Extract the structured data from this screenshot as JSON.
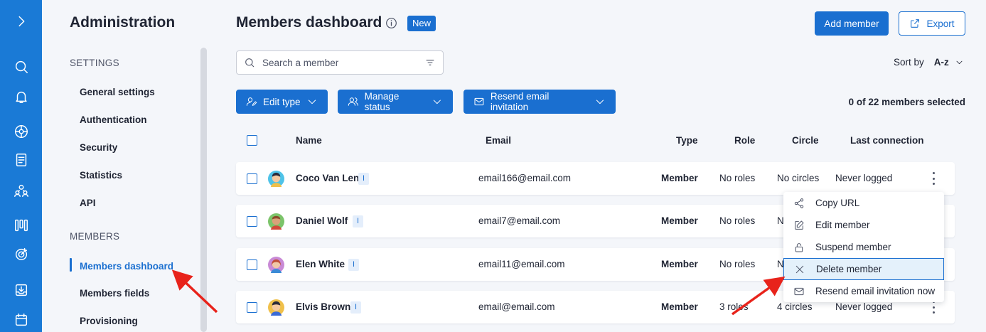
{
  "rail": {
    "icons": [
      "chevron-right-icon",
      "search-icon",
      "bell-icon",
      "compass-icon",
      "document-icon",
      "people-icon",
      "columns-icon",
      "target-icon",
      "inbox-icon",
      "calendar-icon"
    ]
  },
  "sidebar": {
    "title": "Administration",
    "settings_label": "SETTINGS",
    "settings_items": [
      "General settings",
      "Authentication",
      "Security",
      "Statistics",
      "API"
    ],
    "members_label": "MEMBERS",
    "members_items": [
      "Members dashboard",
      "Members fields",
      "Provisioning"
    ],
    "active_item": "Members dashboard"
  },
  "header": {
    "title": "Members dashboard",
    "badge": "New",
    "add_label": "Add member",
    "export_label": "Export"
  },
  "search": {
    "placeholder": "Search a member"
  },
  "sort": {
    "label": "Sort by",
    "value": "A-z"
  },
  "actions": {
    "edit_type": "Edit type",
    "manage_status": "Manage status",
    "resend_invitation": "Resend email invitation",
    "selected_count": "0 of 22 members selected"
  },
  "table": {
    "columns": {
      "name": "Name",
      "email": "Email",
      "type": "Type",
      "role": "Role",
      "circle": "Circle",
      "last": "Last connection"
    },
    "rows": [
      {
        "name": "Coco Van Len",
        "tag": "I",
        "email": "email166@email.com",
        "type": "Member",
        "role": "No roles",
        "circle": "No circles",
        "last": "Never logged"
      },
      {
        "name": "Daniel Wolf",
        "tag": "I",
        "email": "email7@email.com",
        "type": "Member",
        "role": "No roles",
        "circle": "N",
        "last": ""
      },
      {
        "name": "Elen White",
        "tag": "I",
        "email": "email11@email.com",
        "type": "Member",
        "role": "No roles",
        "circle": "N",
        "last": ""
      },
      {
        "name": "Elvis Brown",
        "tag": "I",
        "email": "email@email.com",
        "type": "Member",
        "role": "3 roles",
        "circle": "4 circles",
        "last": "Never logged"
      }
    ]
  },
  "menu": {
    "items": [
      "Copy URL",
      "Edit member",
      "Suspend member",
      "Delete member",
      "Resend email invitation now"
    ],
    "highlighted": "Delete member"
  },
  "colors": {
    "brand": "#1a6fd0",
    "rail": "#1a7ad6",
    "arrow": "#e8231b"
  }
}
